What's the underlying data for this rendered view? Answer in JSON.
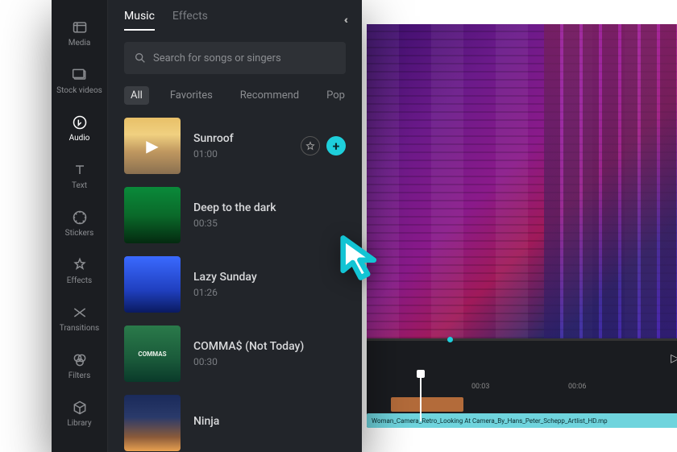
{
  "sidebar": {
    "items": [
      {
        "label": "Media"
      },
      {
        "label": "Stock videos"
      },
      {
        "label": "Audio"
      },
      {
        "label": "Text"
      },
      {
        "label": "Stickers"
      },
      {
        "label": "Effects"
      },
      {
        "label": "Transitions"
      },
      {
        "label": "Filters"
      },
      {
        "label": "Library"
      }
    ]
  },
  "tabs": {
    "music": "Music",
    "effects": "Effects"
  },
  "search": {
    "placeholder": "Search for songs or singers"
  },
  "filters": {
    "all": "All",
    "favorites": "Favorites",
    "recommend": "Recommend",
    "pop": "Pop"
  },
  "tracks": [
    {
      "name": "Sunroof",
      "duration": "01:00"
    },
    {
      "name": "Deep to the dark",
      "duration": "00:35"
    },
    {
      "name": "Lazy Sunday",
      "duration": "01:26"
    },
    {
      "name": "COMMA$ (Not Today)",
      "duration": "00:30"
    },
    {
      "name": "Ninja",
      "duration": ""
    }
  ],
  "timeline": {
    "marks": [
      "00:03",
      "00:06"
    ],
    "clip_label": "Woman_Camera_Retro_Looking At Camera_By_Hans_Peter_Schepp_Artlist_HD.mp",
    "thumb_commas": "COMMAS"
  }
}
